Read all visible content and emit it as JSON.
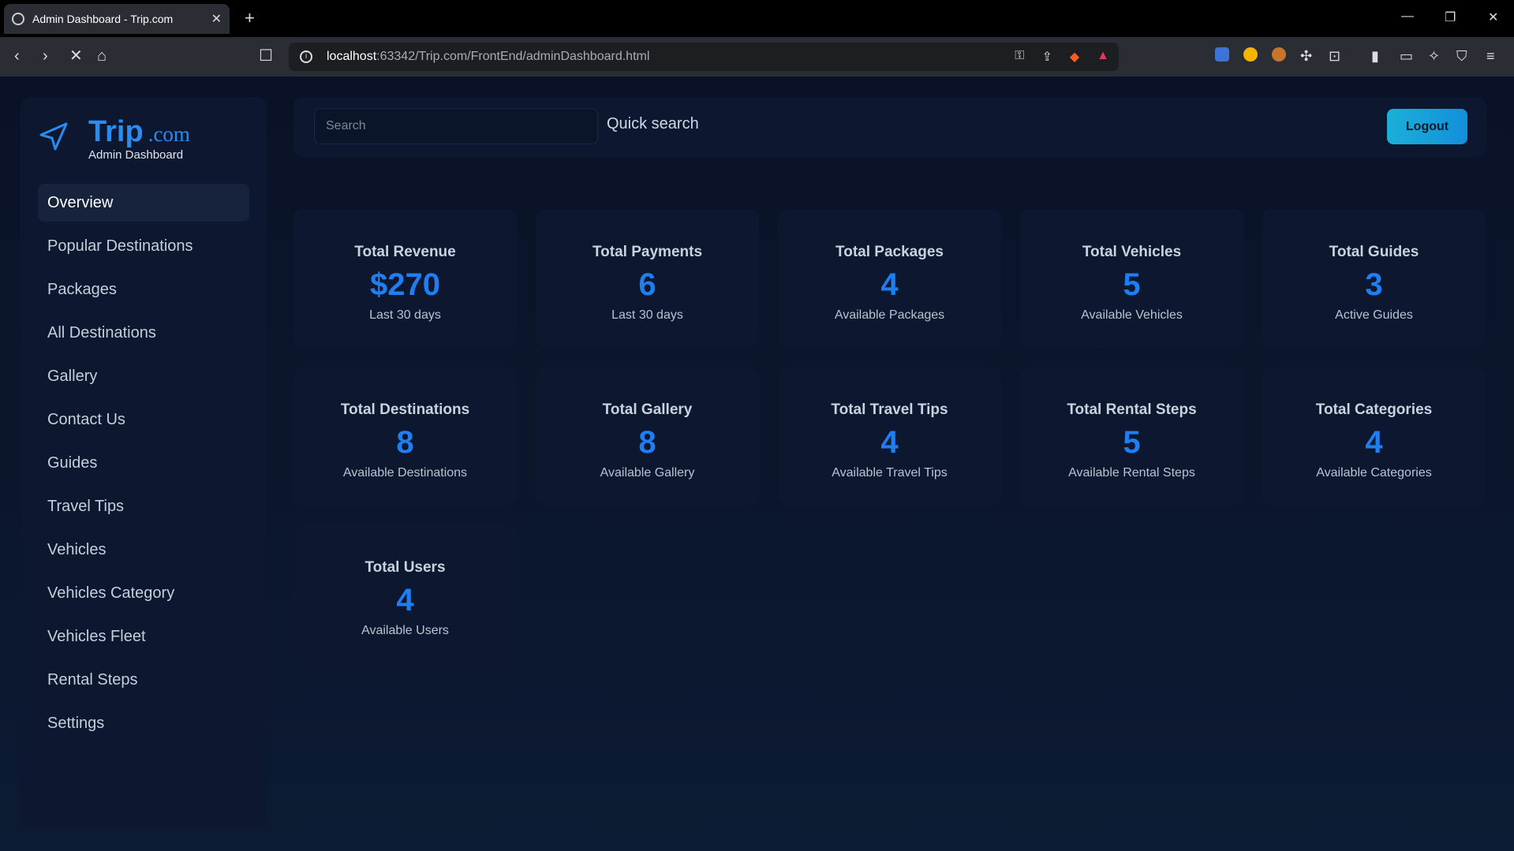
{
  "browser": {
    "tab_title": "Admin Dashboard - Trip.com",
    "url_host": "localhost",
    "url_path": ":63342/Trip.com/FrontEnd/adminDashboard.html"
  },
  "brand": {
    "name": "Trip",
    "suffix": ".com",
    "subtitle": "Admin Dashboard",
    "color": "#2a8cf0"
  },
  "sidebar": {
    "items": [
      {
        "label": "Overview",
        "active": true
      },
      {
        "label": "Popular Destinations"
      },
      {
        "label": "Packages"
      },
      {
        "label": "All Destinations"
      },
      {
        "label": "Gallery"
      },
      {
        "label": "Contact Us"
      },
      {
        "label": "Guides"
      },
      {
        "label": "Travel Tips"
      },
      {
        "label": "Vehicles"
      },
      {
        "label": "Vehicles Category"
      },
      {
        "label": "Vehicles Fleet"
      },
      {
        "label": "Rental Steps"
      },
      {
        "label": "Settings"
      }
    ]
  },
  "topbar": {
    "search_placeholder": "Search",
    "quick_search": "Quick search",
    "logout_label": "Logout"
  },
  "stats": [
    {
      "label": "Total Revenue",
      "value": "$270",
      "note": "Last 30 days"
    },
    {
      "label": "Total Payments",
      "value": "6",
      "note": "Last 30 days"
    },
    {
      "label": "Total Packages",
      "value": "4",
      "note": "Available Packages"
    },
    {
      "label": "Total Vehicles",
      "value": "5",
      "note": "Available Vehicles"
    },
    {
      "label": "Total Guides",
      "value": "3",
      "note": "Active Guides"
    },
    {
      "label": "Total Destinations",
      "value": "8",
      "note": "Available Destinations"
    },
    {
      "label": "Total Gallery",
      "value": "8",
      "note": "Available Gallery"
    },
    {
      "label": "Total Travel Tips",
      "value": "4",
      "note": "Available Travel Tips"
    },
    {
      "label": "Total Rental Steps",
      "value": "5",
      "note": "Available Rental Steps"
    },
    {
      "label": "Total Categories",
      "value": "4",
      "note": "Available Categories"
    },
    {
      "label": "Total Users",
      "value": "4",
      "note": "Available Users"
    }
  ],
  "colors": {
    "accent": "#1f7ef0",
    "logout": "#1bb0d8",
    "background": "#0b1428",
    "card": "#0d1730"
  }
}
